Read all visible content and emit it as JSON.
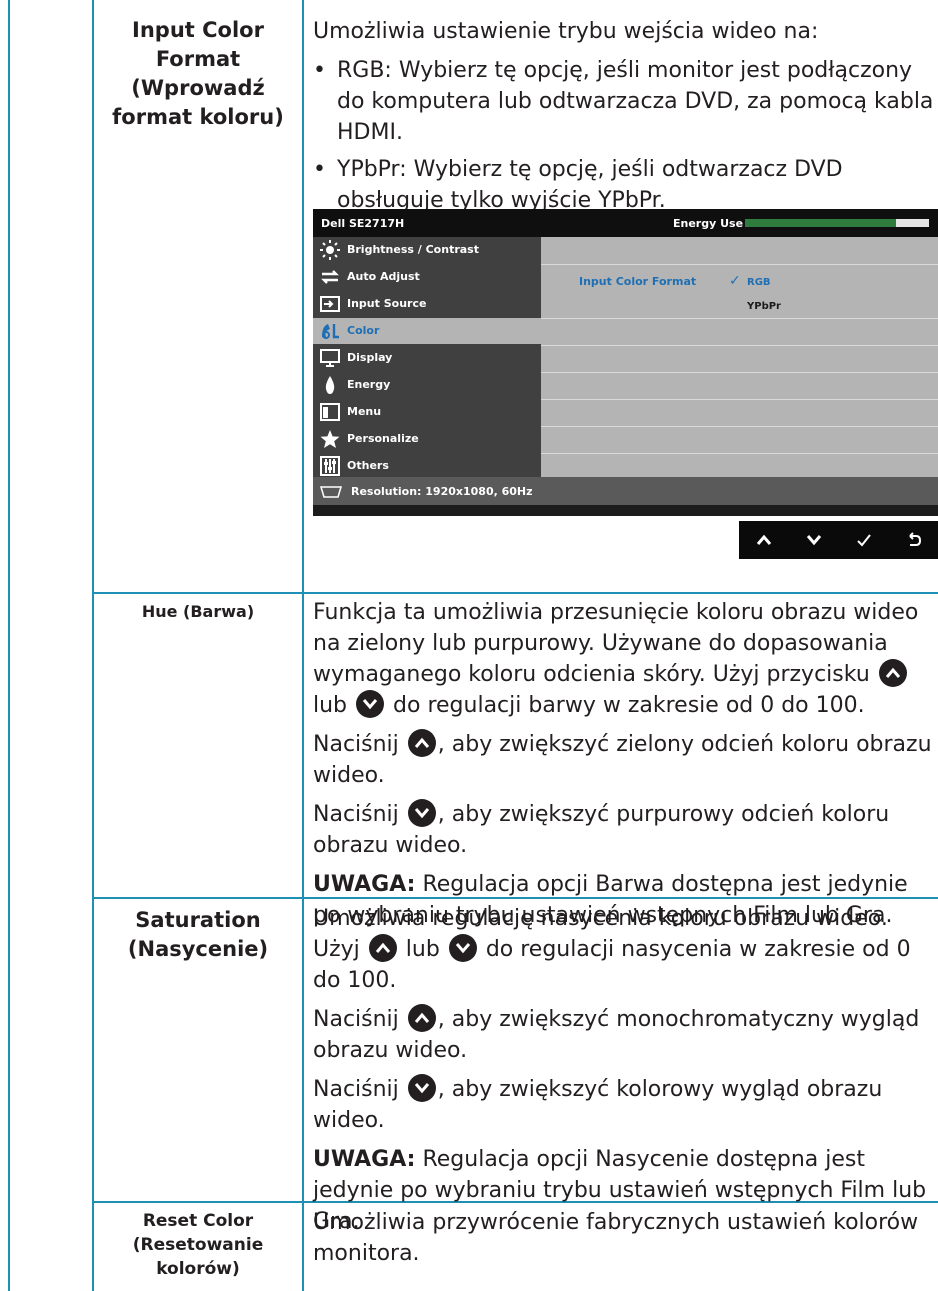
{
  "rows": {
    "input_color_format": {
      "label": "Input Color Format (Wprowadź format koloru)",
      "intro": "Umożliwia ustawienie trybu wejścia wideo na:",
      "bullets": [
        "RGB: Wybierz tę opcję, jeśli monitor jest podłączony do komputera lub odtwarzacza DVD, za pomocą kabla HDMI.",
        "YPbPr: Wybierz tę opcję, jeśli odtwarzacz DVD obsługuje tylko wyjście YPbPr."
      ]
    },
    "hue": {
      "label": "Hue (Barwa)",
      "p1_a": "Funkcja ta umożliwia przesunięcie koloru obrazu wideo na zielony lub purpurowy. Używane do dopasowania wymaganego koloru odcienia skóry. Użyj przycisku",
      "p1_b": "lub",
      "p1_c": "do regulacji barwy w zakresie od 0 do 100.",
      "p2_a": "Naciśnij",
      "p2_b": ", aby zwiększyć zielony odcień koloru obrazu wideo.",
      "p3_a": "Naciśnij",
      "p3_b": ", aby zwiększyć purpurowy odcień koloru obrazu wideo.",
      "note_label": "UWAGA:",
      "note_text": " Regulacja opcji Barwa dostępna jest jedynie po wybraniu trybu ustawień wstępnych Film lub Gra."
    },
    "saturation": {
      "label": "Saturation (Nasycenie)",
      "p1": "Umożliwia regulację nasycenia koloru obrazu wideo.",
      "p1_a": "Użyj",
      "p1_b": "lub",
      "p1_c": "do regulacji nasycenia w zakresie od 0 do 100.",
      "p2_a": "Naciśnij",
      "p2_b": ", aby zwiększyć monochromatyczny wygląd obrazu wideo.",
      "p3_a": "Naciśnij",
      "p3_b": ", aby zwiększyć kolorowy wygląd obrazu wideo.",
      "note_label": "UWAGA:",
      "note_text": " Regulacja opcji Nasycenie dostępna jest jedynie po wybraniu trybu ustawień wstępnych Film lub Gra."
    },
    "reset_color": {
      "label": "Reset Color (Resetowanie kolorów)",
      "desc": "Umożliwia przywrócenie fabrycznych ustawień kolorów monitora."
    }
  },
  "osd": {
    "model": "Dell SE2717H",
    "energy_label": "Energy Use",
    "energy_level": 0.82,
    "menu": [
      {
        "label": "Brightness / Contrast",
        "icon": "brightness-icon"
      },
      {
        "label": "Auto Adjust",
        "icon": "auto-adjust-icon"
      },
      {
        "label": "Input Source",
        "icon": "input-source-icon"
      },
      {
        "label": "Color",
        "icon": "color-icon",
        "selected": true
      },
      {
        "label": "Display",
        "icon": "display-icon"
      },
      {
        "label": "Energy",
        "icon": "energy-icon"
      },
      {
        "label": "Menu",
        "icon": "menu-icon"
      },
      {
        "label": "Personalize",
        "icon": "personalize-icon"
      },
      {
        "label": "Others",
        "icon": "others-icon"
      }
    ],
    "option_label": "Input Color Format",
    "option_selected": "RGB",
    "option_other": "YPbPr",
    "resolution": "Resolution: 1920x1080, 60Hz"
  },
  "colors": {
    "border": "#1f8fb4",
    "accent": "#1f6fb4"
  }
}
